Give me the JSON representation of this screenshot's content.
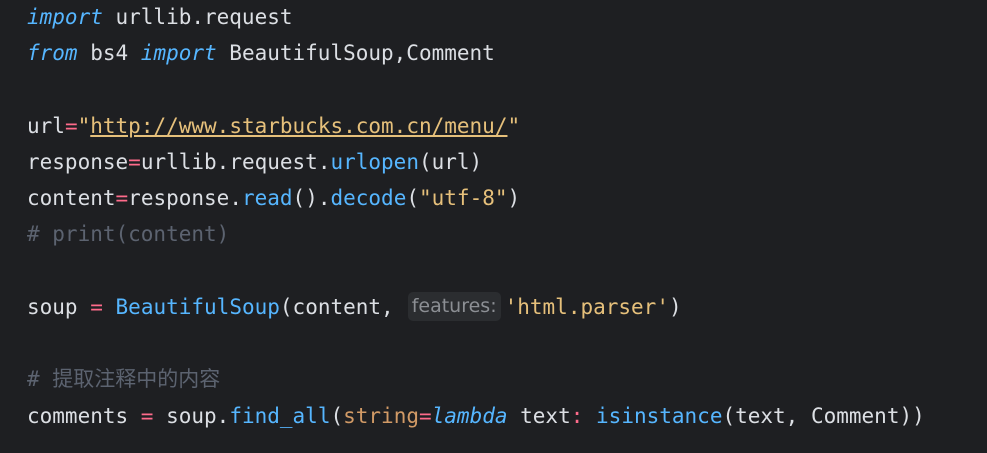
{
  "code": {
    "l1": {
      "kw": "import",
      "rest": " urllib.request"
    },
    "l2": {
      "kw1": "from",
      "mod": " bs4 ",
      "kw2": "import",
      "rest": " BeautifulSoup,Comment"
    },
    "l4": {
      "var": "url",
      "eq": "=",
      "q1": "\"",
      "url": "http://www.starbucks.com.cn/menu/",
      "q2": "\""
    },
    "l5": {
      "var": "response",
      "eq": "=",
      "obj": "urllib.request.",
      "fn": "urlopen",
      "args": "(url)"
    },
    "l6": {
      "var": "content",
      "eq": "=",
      "obj": "response.",
      "fn1": "read",
      "mid": "().",
      "fn2": "decode",
      "open": "(",
      "str": "\"utf-8\"",
      "close": ")"
    },
    "l7": {
      "comment": "# print(content)"
    },
    "l9": {
      "var": "soup ",
      "eq": "=",
      "sp": " ",
      "fn": "BeautifulSoup",
      "args": "(content,",
      "hint": "features:",
      "str": "'html.parser'",
      "close": ")"
    },
    "l11": {
      "comment": "# 提取注释中的内容"
    },
    "l12": {
      "var": "comments ",
      "eq": "=",
      "obj": " soup.",
      "fn": "find_all",
      "open": "(",
      "param": "string",
      "eq2": "=",
      "lambda": "lambda",
      "text": " text",
      "colon": ":",
      "sp": " ",
      "fn2": "isinstance",
      "rest": "(text, Comment))"
    }
  },
  "colors": {
    "background": "#1e1f22",
    "keyword": "#56b6ff",
    "operator": "#ff6b8b",
    "string": "#e6c07b",
    "comment": "#5c6370",
    "default": "#dcdfe4"
  }
}
